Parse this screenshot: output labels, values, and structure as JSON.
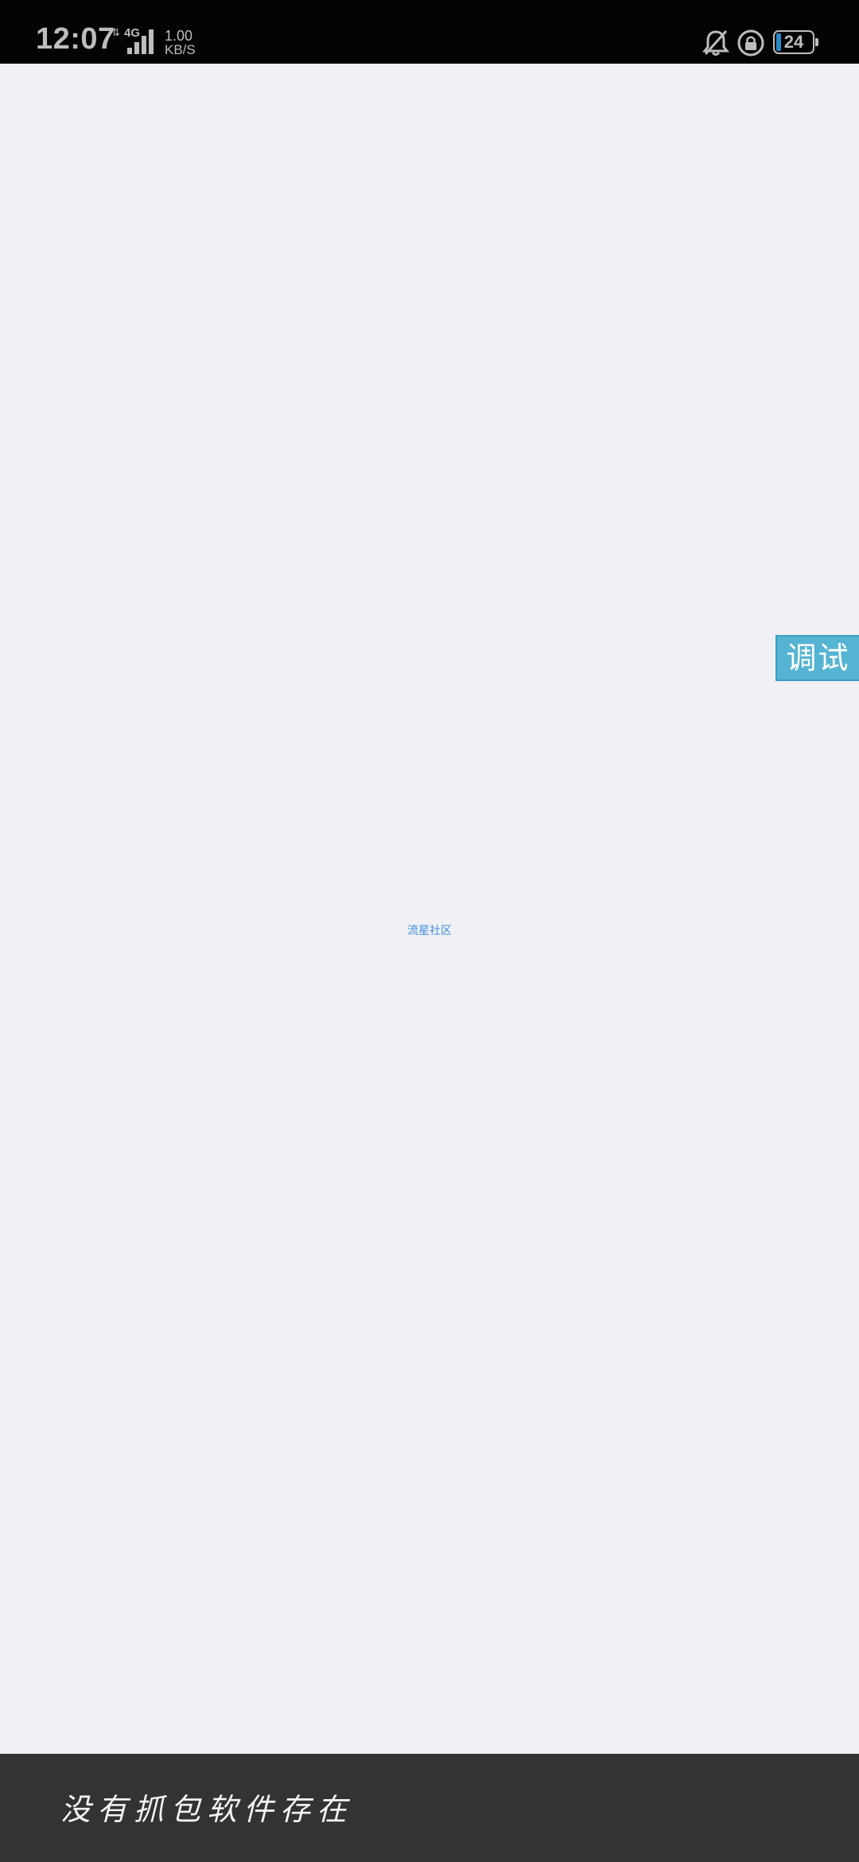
{
  "status_bar": {
    "time": "12:07",
    "network_arrows": "⇅",
    "network_type": "4G",
    "speed_value": "1.00",
    "speed_unit": "KB/S",
    "battery_level": "24",
    "icons": [
      "signal-icon",
      "mute-bell-icon",
      "rotation-lock-icon",
      "battery-icon"
    ],
    "battery_accent": "#2a89c9"
  },
  "debug_button": {
    "label": "调试",
    "color": "#55b4d3"
  },
  "center_link": {
    "text": "流星社区",
    "color": "#3f8fdc"
  },
  "toast": {
    "message": "没有抓包软件存在",
    "background": "#333333"
  },
  "page": {
    "background": "#f0f0f5"
  }
}
